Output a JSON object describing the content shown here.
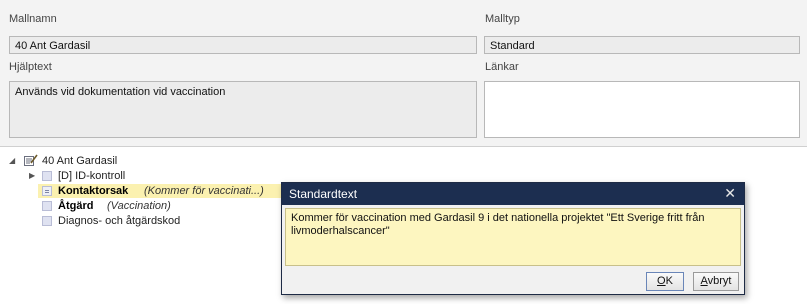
{
  "form": {
    "mallnamn_label": "Mallnamn",
    "mallnamn_value": "40 Ant Gardasil",
    "malltyp_label": "Malltyp",
    "malltyp_value": "Standard",
    "hjalptext_label": "Hjälptext",
    "hjalptext_value": "Används vid dokumentation vid vaccination",
    "lankar_label": "Länkar",
    "lankar_value": ""
  },
  "tree": {
    "root_label": "40 Ant Gardasil",
    "items": [
      {
        "label": "[D] ID-kontroll",
        "value": ""
      },
      {
        "label": "Kontaktorsak",
        "value": "(Kommer för vaccinati...)"
      },
      {
        "label": "Åtgärd",
        "value": "(Vaccination)"
      },
      {
        "label": "Diagnos- och åtgärdskod",
        "value": ""
      }
    ]
  },
  "dialog": {
    "title": "Standardtext",
    "close": "✕",
    "text": "Kommer för vaccination med Gardasil 9 i det nationella projektet \"Ett Sverige fritt från livmoderhalscancer\"",
    "ok_u": "O",
    "ok_rest": "K",
    "cancel_u": "A",
    "cancel_rest": "vbryt"
  },
  "colors": {
    "dialog_title_bg": "#1c2e50",
    "selection_bg": "#fbf1b0",
    "dialog_text_bg": "#fdf6c0"
  }
}
